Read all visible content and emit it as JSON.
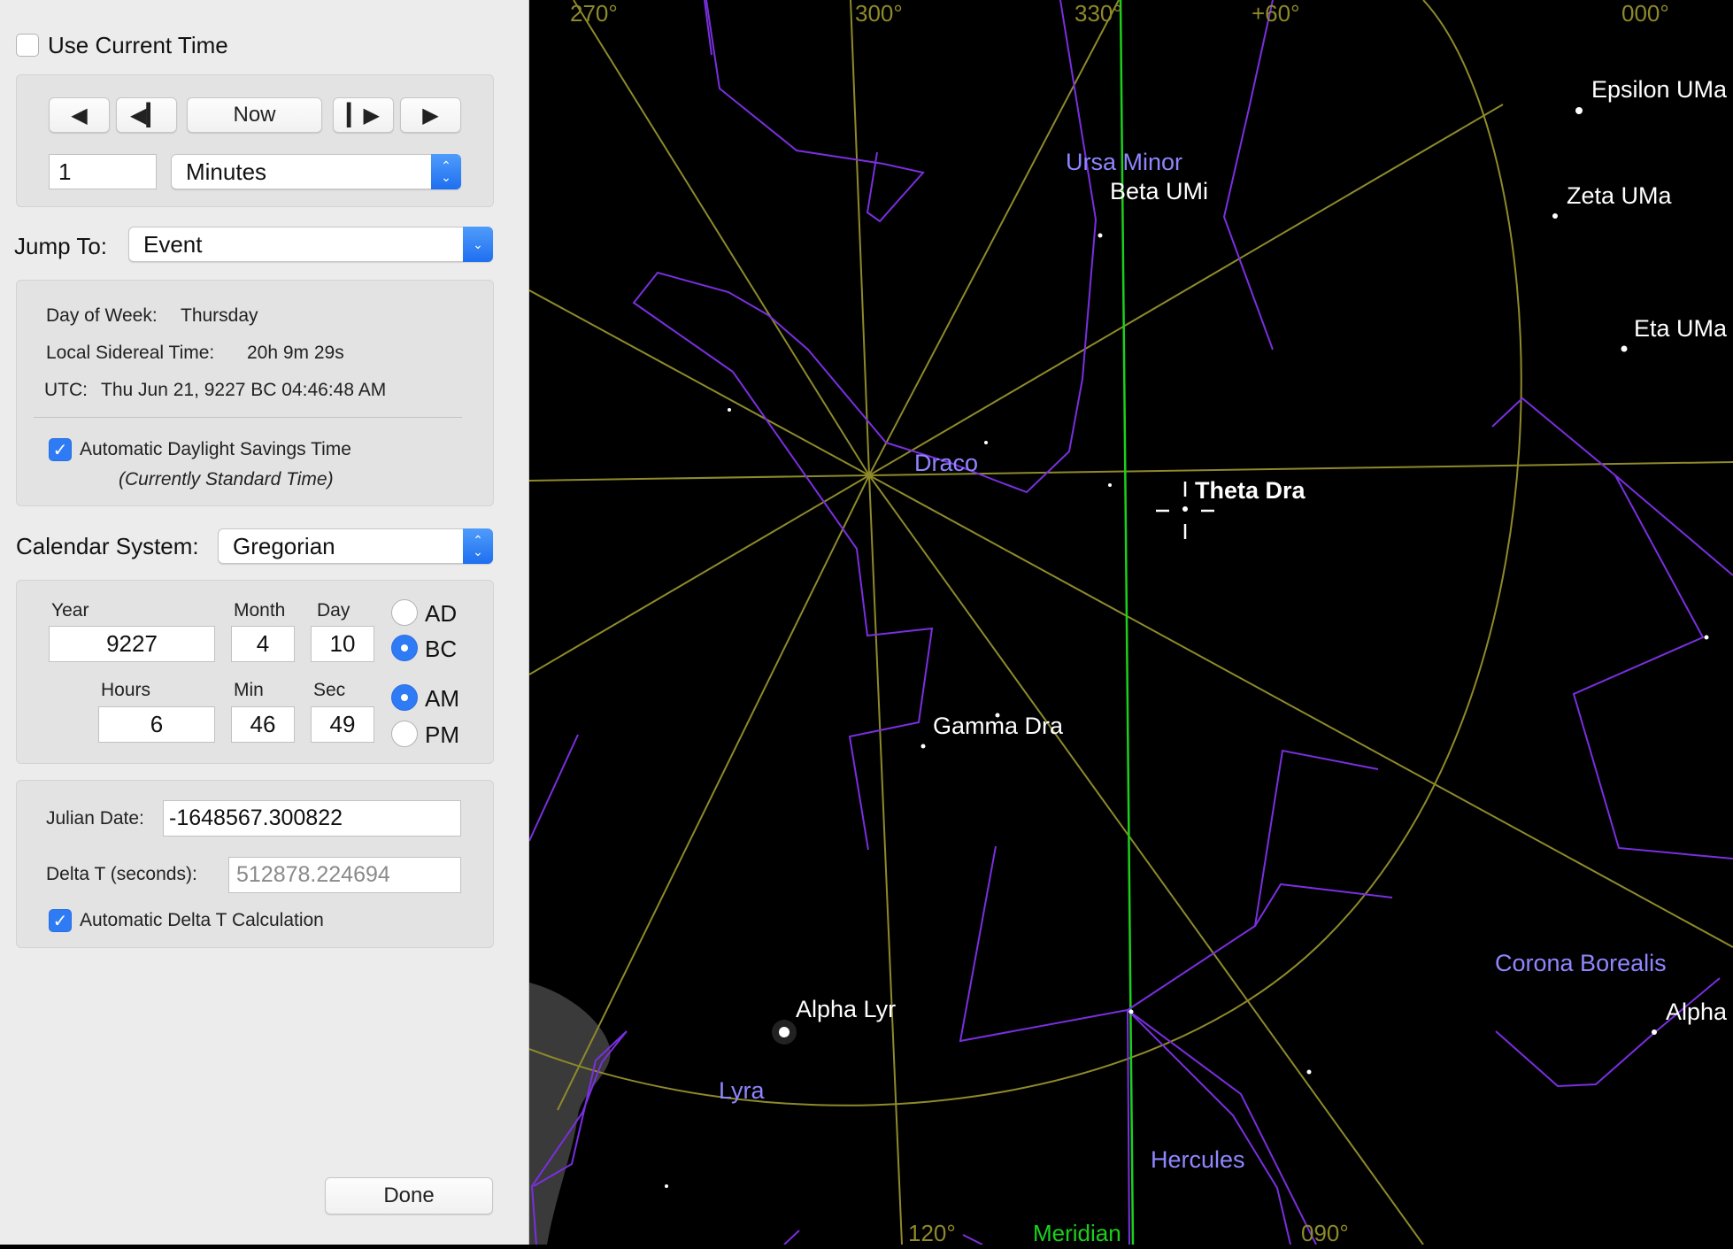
{
  "use_current_time": {
    "label": "Use Current Time",
    "checked": false
  },
  "step": {
    "buttons": {
      "back": "◀",
      "step_back": "◀▎",
      "now": "Now",
      "step_fwd": "▎▶",
      "fwd": "▶"
    },
    "value": "1",
    "unit": "Minutes"
  },
  "jump_to": {
    "label": "Jump To:",
    "value": "Event"
  },
  "info": {
    "day_of_week_label": "Day of Week:",
    "day_of_week": "Thursday",
    "lst_label": "Local Sidereal Time:",
    "lst": "20h 9m 29s",
    "utc_label": "UTC:",
    "utc": "Thu Jun 21, 9227 BC 04:46:48 AM",
    "dst_label": "Automatic Daylight Savings Time",
    "dst_checked": true,
    "dst_note": "(Currently Standard Time)"
  },
  "calendar": {
    "label": "Calendar System:",
    "value": "Gregorian"
  },
  "date": {
    "year_label": "Year",
    "month_label": "Month",
    "day_label": "Day",
    "year": "9227",
    "month": "4",
    "day": "10",
    "ad_label": "AD",
    "bc_label": "BC",
    "era_selected": "BC",
    "hours_label": "Hours",
    "min_label": "Min",
    "sec_label": "Sec",
    "hours": "6",
    "min": "46",
    "sec": "49",
    "am_label": "AM",
    "pm_label": "PM",
    "ampm_selected": "AM"
  },
  "julian": {
    "jd_label": "Julian Date:",
    "jd": "-1648567.300822",
    "delta_label": "Delta T (seconds):",
    "delta": "512878.224694",
    "auto_label": "Automatic Delta T Calculation",
    "auto_checked": true
  },
  "done_label": "Done",
  "sky": {
    "colors": {
      "background": "#000000",
      "grid": "#8e8a2a",
      "constellation": "#7a2fe0",
      "meridian": "#1bd01b",
      "label_constellation": "#8f86ff",
      "label_star": "#ffffff",
      "label_grid": "#8e8a2a"
    },
    "grid_labels": {
      "ra270": "270°",
      "ra300": "300°",
      "ra330": "330°",
      "dec60": "+60°",
      "ra000": "000°",
      "ra120": "120°",
      "ra090": "090°"
    },
    "meridian_label": "Meridian",
    "constellations": {
      "ursa_minor": "Ursa Minor",
      "draco": "Draco",
      "lyra": "Lyra",
      "hercules": "Hercules",
      "corona_borealis": "Corona Borealis"
    },
    "stars": {
      "epsilon_uma": "Epsilon UMa",
      "zeta_uma": "Zeta UMa",
      "eta_uma": "Eta UMa",
      "beta_umi": "Beta UMi",
      "theta_dra": "Theta Dra",
      "gamma_dra": "Gamma Dra",
      "alpha_lyr": "Alpha Lyr",
      "alpha_crb": "Alpha"
    }
  }
}
